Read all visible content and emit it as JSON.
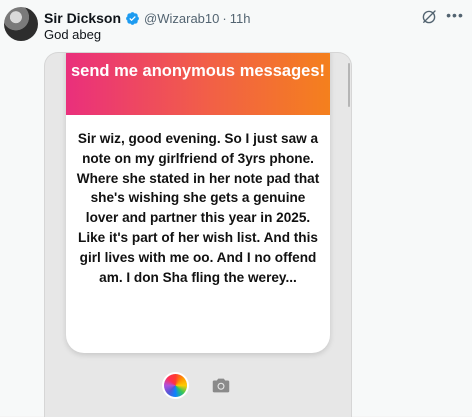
{
  "tweet": {
    "author_name": "Sir Dickson",
    "handle": "@Wizarab10",
    "separator": "·",
    "time": "11h",
    "text": "God abeg"
  },
  "card": {
    "header": "send me anonymous messages!",
    "message": "Sir wiz, good evening. So I just saw a note on my girlfriend of 3yrs phone. Where she stated in her note pad that she's wishing she gets a genuine lover and partner this year in 2025. Like it's part of her wish list. And this girl lives with me oo. And I no offend am. I don Sha fling the werey..."
  },
  "icons": {
    "verified": "verified-badge-icon",
    "grok": "grok-icon",
    "more": "more-options-icon",
    "color": "color-wheel-icon",
    "camera": "camera-icon"
  },
  "colors": {
    "verified": "#1d9bf0",
    "gradient_start": "#ea2f7c",
    "gradient_end": "#f4801d"
  }
}
